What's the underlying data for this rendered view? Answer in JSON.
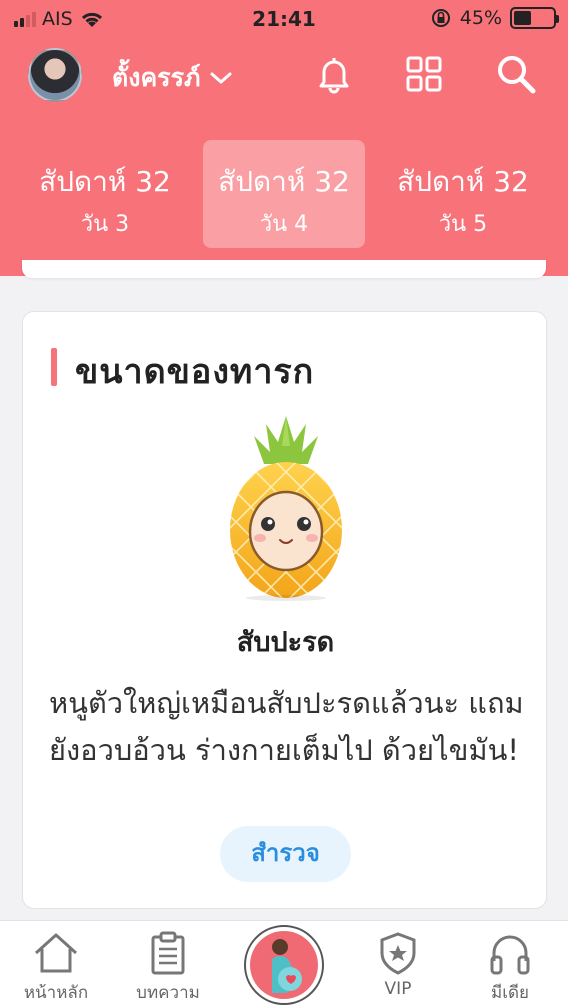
{
  "status": {
    "carrier": "AIS",
    "time": "21:41",
    "battery_percent": "45%",
    "battery_level": 0.45
  },
  "header": {
    "username": "ตั้งครรภ์"
  },
  "weeks": [
    {
      "week": "สัปดาห์ 32",
      "day": "วัน 3"
    },
    {
      "week": "สัปดาห์ 32",
      "day": "วัน 4"
    },
    {
      "week": "สัปดาห์ 32",
      "day": "วัน 5"
    }
  ],
  "card": {
    "title": "ขนาดของทารก",
    "fruit_name": "สับปะรด",
    "description": "หนูตัวใหญ่เหมือนสับปะรดแล้วนะ แถมยังอวบอ้วน ร่างกายเต็มไป ด้วยไขมัน!",
    "button": "สำรวจ"
  },
  "tabs": {
    "home": "หน้าหลัก",
    "article": "บทความ",
    "vip": "VIP",
    "media": "มีเดีย"
  },
  "colors": {
    "brand": "#f8727a",
    "link": "#2a8ee0"
  }
}
